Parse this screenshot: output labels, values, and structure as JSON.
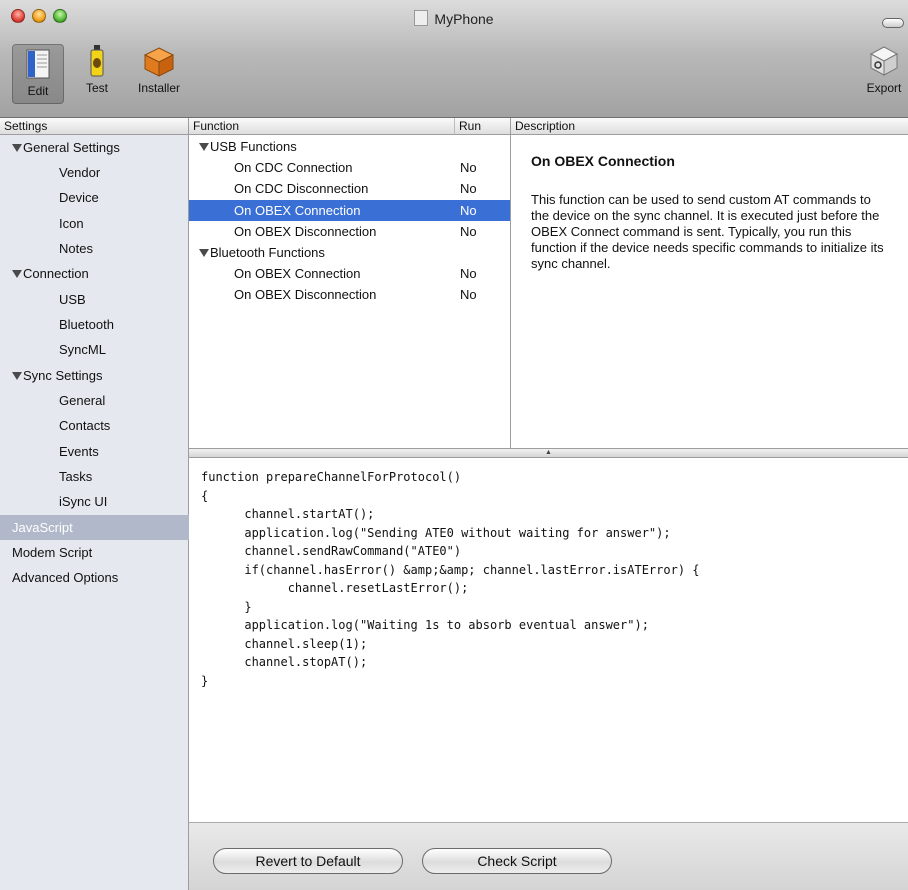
{
  "window": {
    "title": "MyPhone"
  },
  "toolbar": {
    "edit_label": "Edit",
    "test_label": "Test",
    "installer_label": "Installer",
    "export_label": "Export"
  },
  "headers": {
    "settings": "Settings",
    "function": "Function",
    "run": "Run",
    "description": "Description"
  },
  "sidebar": {
    "items": [
      {
        "label": "General Settings",
        "kind": "group"
      },
      {
        "label": "Vendor",
        "kind": "child"
      },
      {
        "label": "Device",
        "kind": "child"
      },
      {
        "label": "Icon",
        "kind": "child"
      },
      {
        "label": "Notes",
        "kind": "child"
      },
      {
        "label": "Connection",
        "kind": "group"
      },
      {
        "label": "USB",
        "kind": "child"
      },
      {
        "label": "Bluetooth",
        "kind": "child"
      },
      {
        "label": "SyncML",
        "kind": "child"
      },
      {
        "label": "Sync Settings",
        "kind": "group"
      },
      {
        "label": "General",
        "kind": "child"
      },
      {
        "label": "Contacts",
        "kind": "child"
      },
      {
        "label": "Events",
        "kind": "child"
      },
      {
        "label": "Tasks",
        "kind": "child"
      },
      {
        "label": "iSync UI",
        "kind": "child"
      },
      {
        "label": "JavaScript",
        "kind": "selected"
      },
      {
        "label": "Modem Script",
        "kind": "plain"
      },
      {
        "label": "Advanced Options",
        "kind": "plain"
      }
    ]
  },
  "functions": {
    "rows": [
      {
        "name": "USB Functions",
        "run": "",
        "kind": "group"
      },
      {
        "name": "On CDC Connection",
        "run": "No",
        "kind": "item"
      },
      {
        "name": "On CDC Disconnection",
        "run": "No",
        "kind": "item"
      },
      {
        "name": "On OBEX Connection",
        "run": "No",
        "kind": "selected"
      },
      {
        "name": "On OBEX Disconnection",
        "run": "No",
        "kind": "item"
      },
      {
        "name": "Bluetooth Functions",
        "run": "",
        "kind": "group"
      },
      {
        "name": "On OBEX Connection",
        "run": "No",
        "kind": "item"
      },
      {
        "name": "On OBEX Disconnection",
        "run": "No",
        "kind": "item"
      }
    ]
  },
  "description": {
    "title": "On OBEX Connection",
    "body": "This function can be used to send custom AT commands to the device on the sync channel. It is executed just before the OBEX Connect command is sent. Typically, you run this function if the device needs specific commands to initialize its sync channel."
  },
  "code": {
    "text": "function prepareChannelForProtocol()\n{\n      channel.startAT();\n      application.log(\"Sending ATE0 without waiting for answer\");\n      channel.sendRawCommand(\"ATE0\")\n      if(channel.hasError() &amp;&amp; channel.lastError.isATError) {\n            channel.resetLastError();\n      }\n      application.log(\"Waiting 1s to absorb eventual answer\");\n      channel.sleep(1);\n      channel.stopAT();\n}"
  },
  "buttons": {
    "revert": "Revert to Default",
    "check": "Check Script"
  }
}
